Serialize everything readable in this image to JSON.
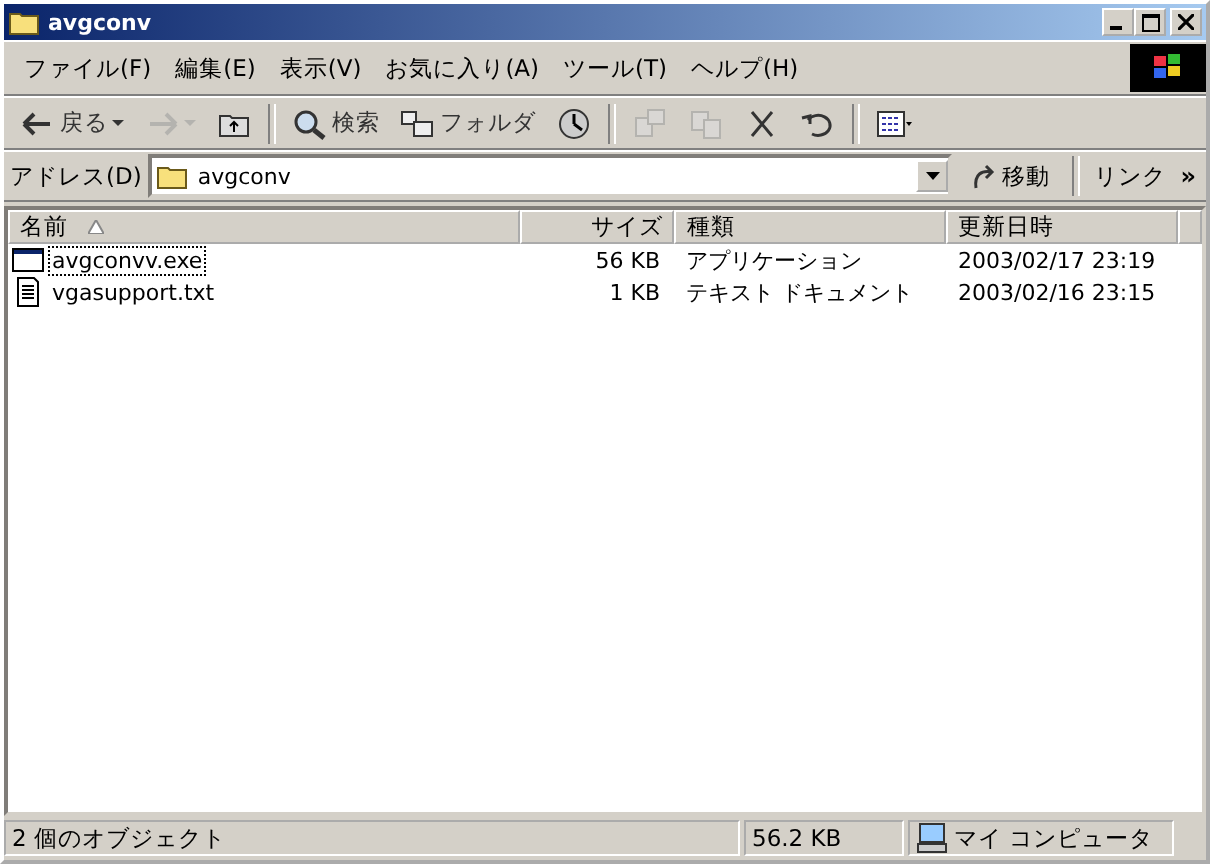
{
  "window": {
    "title": "avgconv"
  },
  "menu": [
    "ファイル(F)",
    "編集(E)",
    "表示(V)",
    "お気に入り(A)",
    "ツール(T)",
    "ヘルプ(H)"
  ],
  "toolbar": [
    {
      "kind": "back",
      "label": "戻る",
      "disabled": false
    },
    {
      "kind": "forward",
      "disabled": true
    },
    {
      "kind": "up",
      "disabled": false
    },
    {
      "kind": "search",
      "label": "検索",
      "disabled": false
    },
    {
      "kind": "folders",
      "label": "フォルダ",
      "disabled": false
    },
    {
      "kind": "history",
      "disabled": false
    },
    {
      "kind": "move",
      "disabled": true
    },
    {
      "kind": "copy",
      "disabled": true
    },
    {
      "kind": "delete",
      "disabled": false
    },
    {
      "kind": "undo",
      "disabled": false
    },
    {
      "kind": "views",
      "disabled": false
    }
  ],
  "address": {
    "label": "アドレス(D)",
    "value": "avgconv",
    "go": "移動",
    "links": "リンク",
    "more": "»"
  },
  "table": {
    "columns": [
      {
        "label": "名前",
        "sorted": true
      },
      {
        "label": "サイズ",
        "sorted": false
      },
      {
        "label": "種類",
        "sorted": false
      },
      {
        "label": "更新日時",
        "sorted": false
      }
    ],
    "rows": [
      {
        "kind": "exe",
        "name": "avgconvv.exe",
        "size": "56 KB",
        "type": "アプリケーション",
        "modified": "2003/02/17 23:19",
        "focused": true
      },
      {
        "kind": "txt",
        "name": "vgasupport.txt",
        "size": "1 KB",
        "type": "テキスト ドキュメント",
        "modified": "2003/02/16 23:15",
        "focused": false
      }
    ]
  },
  "status_bar": {
    "objects": "2 個のオブジェクト",
    "size": "56.2 KB",
    "zone": "マイ コンピュータ"
  }
}
